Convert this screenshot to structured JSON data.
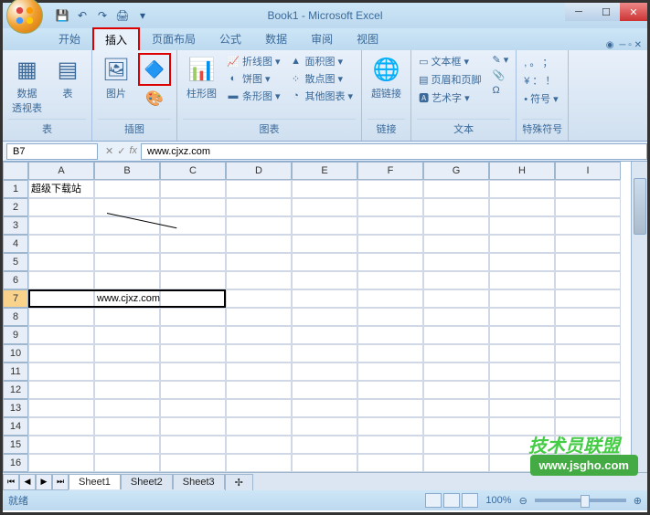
{
  "title": "Book1 - Microsoft Excel",
  "tabs": [
    "开始",
    "插入",
    "页面布局",
    "公式",
    "数据",
    "审阅",
    "视图"
  ],
  "active_tab_index": 1,
  "groups": {
    "tables": {
      "label": "表",
      "pivot": "数据\n透视表",
      "table": "表"
    },
    "illustrations": {
      "label": "插图",
      "picture": "图片",
      "clipart": "",
      "shapes": "",
      "smartart": ""
    },
    "charts": {
      "label": "图表",
      "column": "柱形图",
      "line": "折线图",
      "pie": "饼图",
      "bar": "条形图",
      "area": "面积图",
      "scatter": "散点图",
      "other": "其他图表"
    },
    "links": {
      "label": "链接",
      "hyperlink": "超链接"
    },
    "text": {
      "label": "文本",
      "textbox": "文本框",
      "headerfooter": "页眉和页脚",
      "wordart": "艺术字",
      "sigline": "",
      "object": "Ω"
    },
    "symbols": {
      "label": "特殊符号",
      "symbol": "• 符号"
    }
  },
  "namebox": "B7",
  "formula": "www.cjxz.com",
  "columns": [
    "A",
    "B",
    "C",
    "D",
    "E",
    "F",
    "G",
    "H",
    "I"
  ],
  "cells": {
    "A1": "超级下载站",
    "B7": "www.cjxz.com"
  },
  "selected_row": 7,
  "sheets": [
    "Sheet1",
    "Sheet2",
    "Sheet3"
  ],
  "active_sheet": 0,
  "status": "就绪",
  "zoom": "100%",
  "watermark_text": "技术员联盟",
  "watermark_url": "www.jsgho.com"
}
